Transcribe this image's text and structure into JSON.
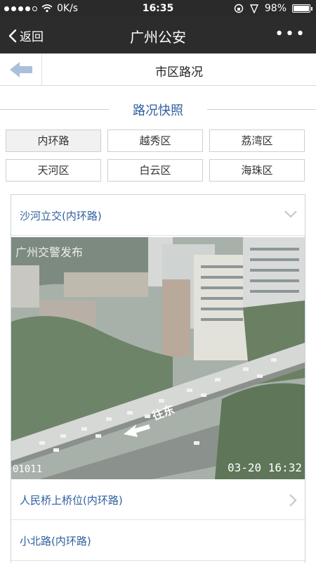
{
  "status_bar": {
    "carrier": "0K/s",
    "time": "16:35",
    "battery": "98%"
  },
  "nav": {
    "back_label": "返回",
    "title": "广州公安",
    "more": "•••"
  },
  "subheader": {
    "title": "市区路况"
  },
  "section": {
    "title": "路况快照"
  },
  "tabs": [
    "内环路",
    "越秀区",
    "荔湾区",
    "天河区",
    "白云区",
    "海珠区"
  ],
  "list": {
    "items": [
      {
        "label": "沙河立交(内环路)",
        "expanded": true
      },
      {
        "label": "人民桥上桥位(内环路)",
        "expanded": false
      },
      {
        "label": "小北路(内环路)",
        "expanded": false
      }
    ]
  },
  "camera": {
    "watermark": "广州交警发布",
    "id": "01011",
    "timestamp": "03-20 16:32",
    "road_sign": "往东"
  },
  "colors": {
    "nav_bg": "#2c2c2c",
    "accent": "#2f5f9e"
  }
}
